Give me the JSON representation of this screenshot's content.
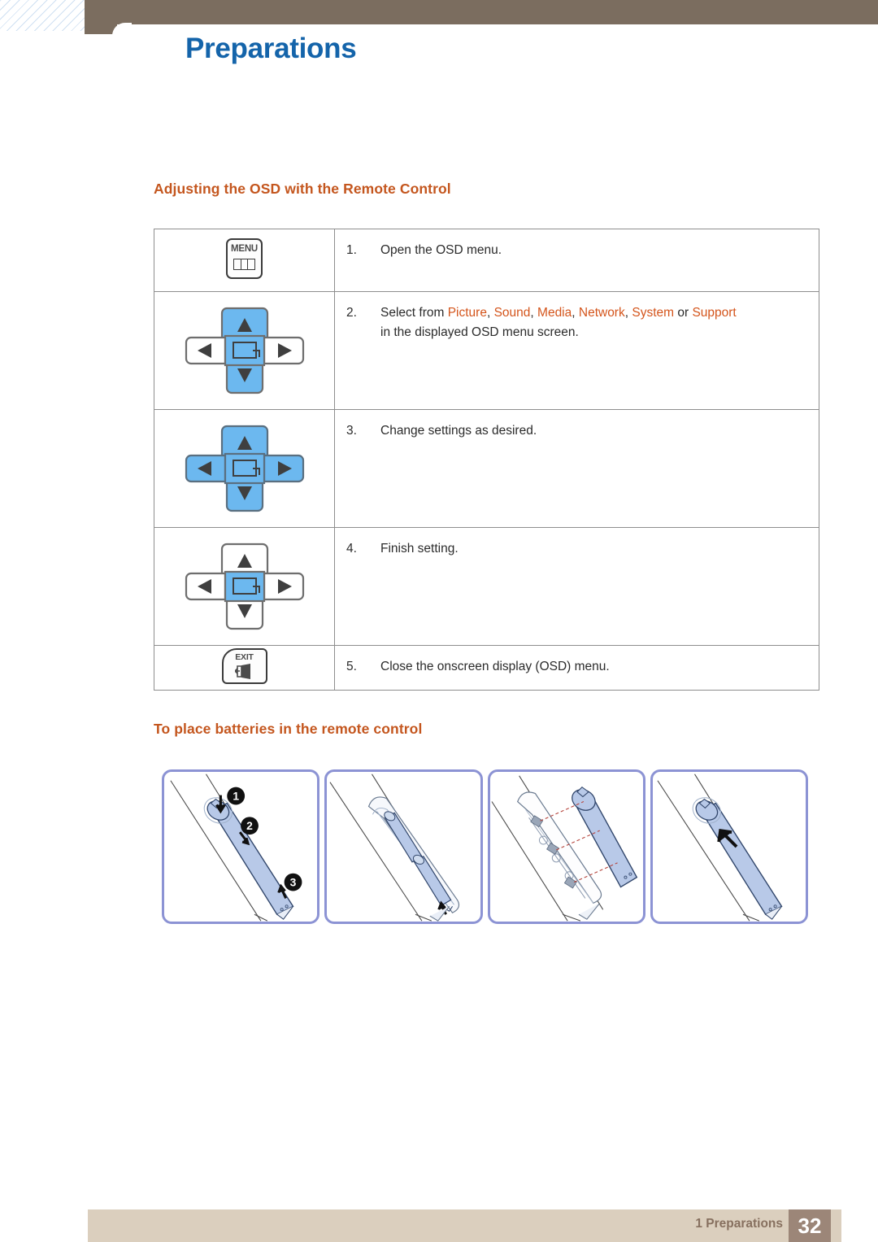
{
  "header": {
    "title": "Preparations",
    "title_color": "#1464aa",
    "bar_color": "#7b6d5f"
  },
  "sections": {
    "osd_heading": "Adjusting the OSD with the Remote Control",
    "batteries_heading": "To place batteries in the remote control",
    "heading_color": "#c4561e"
  },
  "osd_table": {
    "rows": [
      {
        "number": "1.",
        "text": "Open the OSD menu.",
        "icon": "menu-button",
        "icon_label": "MENU",
        "highlight": "none"
      },
      {
        "number": "2.",
        "text_before": "Select from ",
        "keywords": [
          "Picture",
          "Sound",
          "Media",
          "Network",
          "System",
          "Support"
        ],
        "text_conjunction": " or ",
        "text_after": "in the displayed OSD menu screen.",
        "full_text": "Select from Picture, Sound, Media, Network, System or Support in the displayed OSD menu screen.",
        "icon": "dpad-up-down-enter",
        "highlight": "up-down-center"
      },
      {
        "number": "3.",
        "text": "Change settings as desired.",
        "icon": "dpad-all",
        "highlight": "all"
      },
      {
        "number": "4.",
        "text": "Finish setting.",
        "icon": "dpad-enter",
        "highlight": "center"
      },
      {
        "number": "5.",
        "text": "Close the onscreen display (OSD) menu.",
        "icon": "exit-button",
        "icon_label": "EXIT",
        "highlight": "none"
      }
    ],
    "keyword_color": "#d4551c"
  },
  "battery_panels": [
    {
      "caption": "",
      "callouts": [
        "1",
        "2",
        "3"
      ],
      "alt": "slide open the remote control battery cover"
    },
    {
      "caption": "",
      "callouts": [],
      "alt": "insert two AAA batteries matching polarity"
    },
    {
      "caption": "",
      "callouts": [],
      "alt": "align the battery cover with the remote control"
    },
    {
      "caption": "",
      "callouts": [],
      "alt": "slide the cover back into place"
    }
  ],
  "panel_border_color": "#8c93d4",
  "footer": {
    "chapter": "1 Preparations",
    "page_number": "32",
    "bar_color": "#dbcfbe",
    "page_box_color": "#9c8678",
    "text_color": "#87705f"
  }
}
